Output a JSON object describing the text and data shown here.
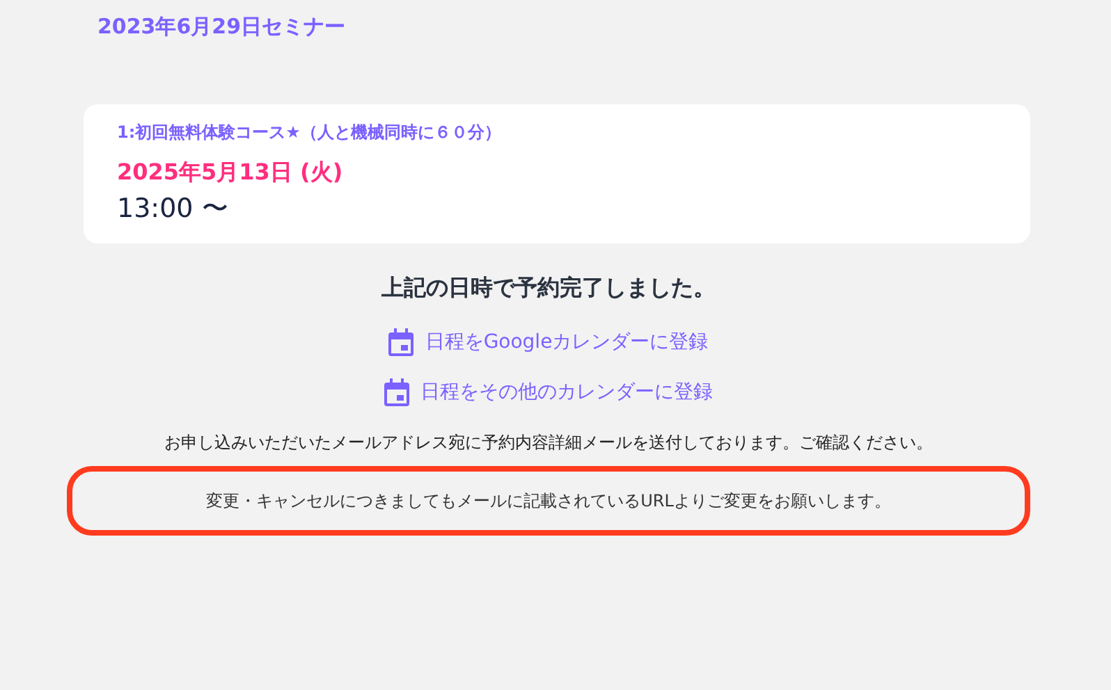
{
  "seminar_title": "2023年6月29日セミナー",
  "booking": {
    "course": "1:初回無料体験コース★（人と機械同時に６０分）",
    "date": "2025年5月13日 (火)",
    "time": "13:00 〜"
  },
  "confirmation": "上記の日時で予約完了しました。",
  "calendar_links": [
    {
      "label": "日程をGoogleカレンダーに登録"
    },
    {
      "label": "日程をその他のカレンダーに登録"
    }
  ],
  "email_notice": "お申し込みいただいたメールアドレス宛に予約内容詳細メールを送付しております。ご確認ください。",
  "change_notice": "変更・キャンセルにつきましてもメールに記載されているURLよりご変更をお願いします。"
}
